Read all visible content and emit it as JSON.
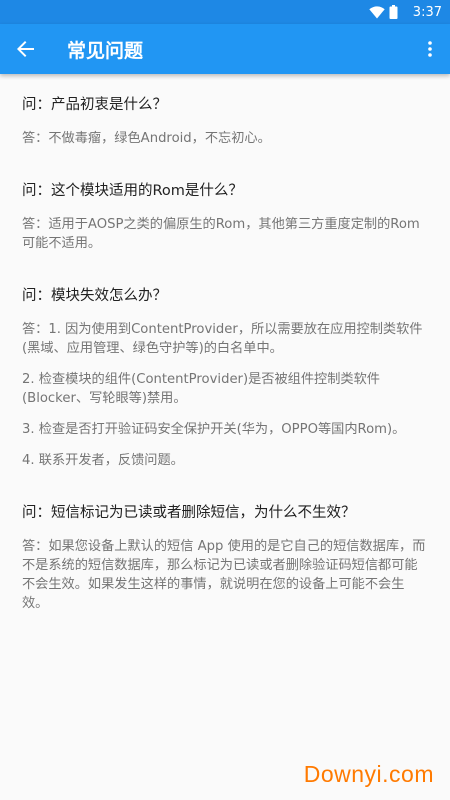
{
  "status_bar": {
    "time": "3:37"
  },
  "app_bar": {
    "title": "常见问题"
  },
  "faqs": [
    {
      "q": "问：产品初衷是什么？",
      "a": [
        "答：不做毒瘤，绿色Android，不忘初心。"
      ]
    },
    {
      "q": "问：这个模块适用的Rom是什么？",
      "a": [
        "答：适用于AOSP之类的偏原生的Rom，其他第三方重度定制的Rom可能不适用。"
      ]
    },
    {
      "q": "问：模块失效怎么办？",
      "a": [
        "答：1. 因为使用到ContentProvider，所以需要放在应用控制类软件(黑域、应用管理、绿色守护等)的白名单中。",
        "2. 检查模块的组件(ContentProvider)是否被组件控制类软件(Blocker、写轮眼等)禁用。",
        "3. 检查是否打开验证码安全保护开关(华为，OPPO等国内Rom)。",
        "4. 联系开发者，反馈问题。"
      ]
    },
    {
      "q": "问：短信标记为已读或者删除短信，为什么不生效？",
      "a": [
        "答：如果您设备上默认的短信 App 使用的是它自己的短信数据库，而不是系统的短信数据库，那么标记为已读或者删除验证码短信都可能不会生效。如果发生这样的事情，就说明在您的设备上可能不会生效。"
      ]
    }
  ],
  "watermark": "Downyi.com",
  "icons": {
    "back": "arrow-back-icon",
    "menu": "more-vert-icon",
    "wifi": "wifi-icon",
    "battery": "battery-icon"
  },
  "colors": {
    "app_bar": "#2196f3",
    "status_bar": "#1e88e5",
    "watermark": "#ff7a00"
  }
}
